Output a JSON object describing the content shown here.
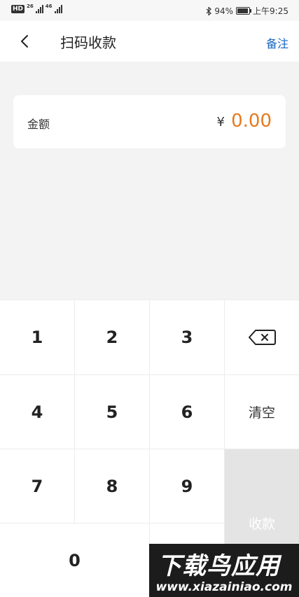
{
  "status_bar": {
    "hd": "HD",
    "net1": "26",
    "net2": "46",
    "battery_pct": "94%",
    "battery_level": 0.94,
    "time": "上午9:25"
  },
  "header": {
    "title": "扫码收款",
    "note_label": "备注"
  },
  "amount_card": {
    "label": "金额",
    "currency": "¥",
    "value": "0.00",
    "value_color": "#e57a1f"
  },
  "keypad": {
    "k1": "1",
    "k2": "2",
    "k3": "3",
    "k4": "4",
    "k5": "5",
    "k6": "6",
    "k7": "7",
    "k8": "8",
    "k9": "9",
    "k0": "0",
    "clear": "清空",
    "collect": "收款",
    "backspace_icon": "backspace-icon"
  },
  "watermark": {
    "brand": "下载鸟应用",
    "url": "www.xiazainiao.com"
  }
}
